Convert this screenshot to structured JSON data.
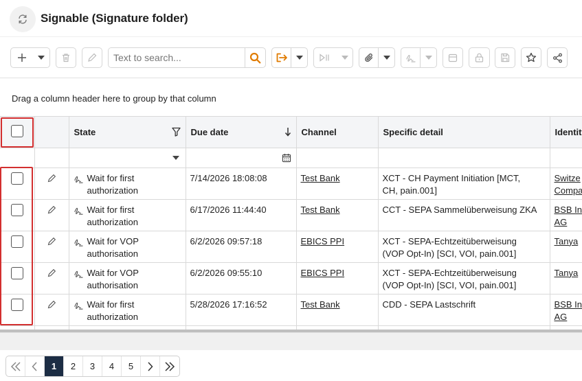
{
  "header": {
    "title": "Signable (Signature folder)"
  },
  "toolbar": {
    "search_placeholder": "Text to search...",
    "icons": [
      "add-icon",
      "trash-icon",
      "pencil-icon",
      "search-icon",
      "export-icon",
      "workflow-icon",
      "attachment-icon",
      "signature-icon",
      "archive-icon",
      "lock-icon",
      "save-icon",
      "star-icon",
      "share-icon"
    ],
    "accent_color": "#e07b00"
  },
  "group_panel": {
    "text": "Drag a column header here to group by that column"
  },
  "grid": {
    "columns": [
      "",
      "",
      "State",
      "Due date",
      "Channel",
      "Specific detail",
      "Identity"
    ],
    "rows": [
      {
        "state": [
          "Wait for first",
          "authorization"
        ],
        "due_date": "7/14/2026 18:08:08",
        "channel": "Test Bank",
        "detail": [
          "XCT - CH Payment Initiation [MCT,",
          "CH, pain.001]"
        ],
        "identity": [
          "Switze",
          "Compa"
        ]
      },
      {
        "state": [
          "Wait for first",
          "authorization"
        ],
        "due_date": "6/17/2026 11:44:40",
        "channel": "Test Bank",
        "detail": [
          "CCT - SEPA Sammelüberweisung ZKA",
          ""
        ],
        "identity": [
          "BSB In",
          "AG"
        ]
      },
      {
        "state": [
          "Wait for VOP",
          "authorisation"
        ],
        "due_date": "6/2/2026 09:57:18",
        "channel": "EBICS PPI",
        "detail": [
          "XCT - SEPA-Echtzeitüberweisung",
          "(VOP Opt-In) [SCI, VOI, pain.001]"
        ],
        "identity": [
          "Tanya",
          ""
        ]
      },
      {
        "state": [
          "Wait for VOP",
          "authorisation"
        ],
        "due_date": "6/2/2026 09:55:10",
        "channel": "EBICS PPI",
        "detail": [
          "XCT - SEPA-Echtzeitüberweisung",
          "(VOP Opt-In) [SCI, VOI, pain.001]"
        ],
        "identity": [
          "Tanya",
          ""
        ]
      },
      {
        "state": [
          "Wait for first",
          "authorization"
        ],
        "due_date": "5/28/2026 17:16:52",
        "channel": "Test Bank",
        "detail": [
          "CDD - SEPA Lastschrift",
          ""
        ],
        "identity": [
          "BSB In",
          "AG"
        ]
      }
    ]
  },
  "pager": {
    "pages": [
      "1",
      "2",
      "3",
      "4",
      "5"
    ],
    "active": "1"
  },
  "highlight_color": "#d32f2f"
}
